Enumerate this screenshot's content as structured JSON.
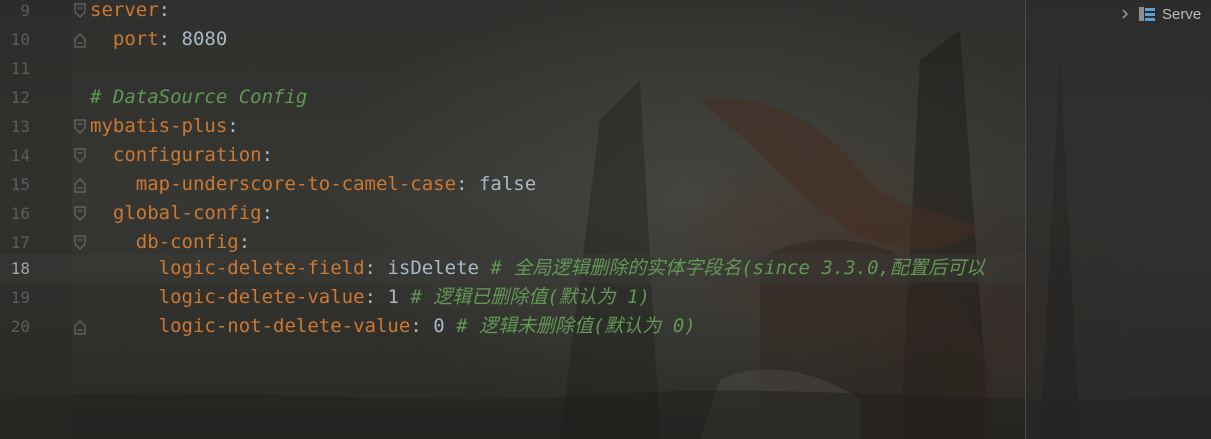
{
  "editor": {
    "active_line_number": "18",
    "lines": [
      {
        "num": "9",
        "indent": "",
        "key": "server",
        "colon": ":",
        "value": "",
        "comment": ""
      },
      {
        "num": "10",
        "indent": "  ",
        "key": "port",
        "colon": ":",
        "value": " 8080",
        "comment": ""
      },
      {
        "num": "11",
        "indent": "",
        "key": "",
        "colon": "",
        "value": "",
        "comment": ""
      },
      {
        "num": "12",
        "indent": "",
        "key": "",
        "colon": "",
        "value": "",
        "comment": "# DataSource Config"
      },
      {
        "num": "13",
        "indent": "",
        "key": "mybatis-plus",
        "colon": ":",
        "value": "",
        "comment": ""
      },
      {
        "num": "14",
        "indent": "  ",
        "key": "configuration",
        "colon": ":",
        "value": "",
        "comment": ""
      },
      {
        "num": "15",
        "indent": "    ",
        "key": "map-underscore-to-camel-case",
        "colon": ":",
        "value": " false",
        "comment": ""
      },
      {
        "num": "16",
        "indent": "  ",
        "key": "global-config",
        "colon": ":",
        "value": "",
        "comment": ""
      },
      {
        "num": "17",
        "indent": "    ",
        "key": "db-config",
        "colon": ":",
        "value": "",
        "comment": ""
      },
      {
        "num": "18",
        "indent": "      ",
        "key": "logic-delete-field",
        "colon": ":",
        "value": " isDelete",
        "comment": " # 全局逻辑删除的实体字段名(since 3.3.0,配置后可以"
      },
      {
        "num": "19",
        "indent": "      ",
        "key": "logic-delete-value",
        "colon": ":",
        "value": " 1",
        "comment": " # 逻辑已删除值(默认为 1)"
      },
      {
        "num": "20",
        "indent": "      ",
        "key": "logic-not-delete-value",
        "colon": ":",
        "value": " 0",
        "comment": " # 逻辑未删除值(默认为 0)"
      }
    ]
  },
  "side_panel": {
    "tree_item_label": "Serve",
    "tree_item_icon": "server-icon",
    "expand_icon": "chevron-right-icon"
  },
  "colors": {
    "key": "#cc7832",
    "comment": "#629755",
    "text": "#a9b7c6",
    "line_number": "#5a5d5c"
  }
}
